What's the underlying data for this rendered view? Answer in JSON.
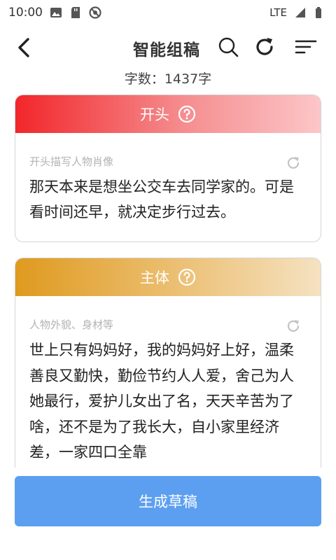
{
  "status_bar": {
    "time": "10:00",
    "network": "LTE"
  },
  "header": {
    "title": "智能组稿"
  },
  "word_count": "字数：1437字",
  "sections": [
    {
      "title": "开头",
      "hint": "开头描写人物肖像",
      "paragraph": "那天本来是想坐公交车去同学家的。可是看时间还早，就决定步行过去。"
    },
    {
      "title": "主体",
      "hint": "人物外貌、身材等",
      "paragraph": "世上只有妈妈好，我的妈妈好上好，温柔善良又勤快，勤俭节约人人爱，舍己为人她最行，爱护儿女出了名，天天辛苦为了啥，还不是为了我长大，自小家里经济差，一家四口全靠"
    }
  ],
  "generate_button": "生成草稿",
  "colors": {
    "primary": "#5c9ff0",
    "opening_head": "#f2262a",
    "body_head": "#df9a1f"
  }
}
